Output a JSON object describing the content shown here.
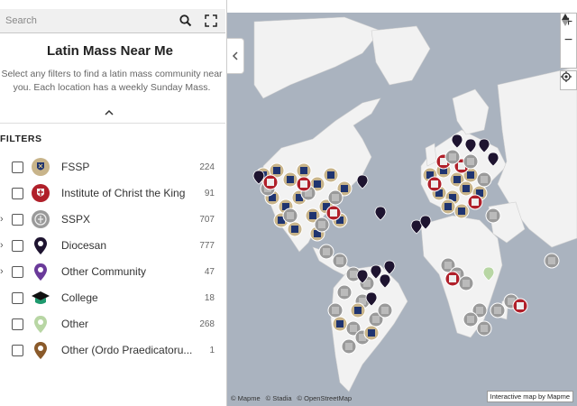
{
  "search": {
    "placeholder": "Search"
  },
  "icons": {
    "search": "search-icon",
    "fullscreen": "fullscreen-icon",
    "collapse": "chevron-up-icon",
    "panel": "chevron-left-icon"
  },
  "sidebar": {
    "title": "Latin Mass Near Me",
    "description": "Select any filters to find a latin mass community near you. Each location has a weekly Sunday Mass.",
    "filters_heading": "FILTERS",
    "filters": [
      {
        "label": "FSSP",
        "count": "224",
        "expandable": false,
        "icon": "fssp-crest-icon"
      },
      {
        "label": "Institute of Christ the King",
        "count": "91",
        "expandable": false,
        "icon": "icrss-crest-icon"
      },
      {
        "label": "SSPX",
        "count": "707",
        "expandable": true,
        "icon": "sspx-crest-icon"
      },
      {
        "label": "Diocesan",
        "count": "777",
        "expandable": true,
        "icon": "map-pin-dark-icon"
      },
      {
        "label": "Other Community",
        "count": "47",
        "expandable": true,
        "icon": "map-pin-purple-icon"
      },
      {
        "label": "College",
        "count": "18",
        "expandable": false,
        "icon": "graduation-cap-icon"
      },
      {
        "label": "Other",
        "count": "268",
        "expandable": false,
        "icon": "map-pin-green-icon"
      },
      {
        "label": "Other (Ordo Praedicatoru...",
        "count": "1",
        "expandable": false,
        "icon": "map-pin-brown-icon"
      }
    ]
  },
  "map": {
    "controls": {
      "zoom_in": "+",
      "zoom_out": "−",
      "compass": "compass-icon",
      "locate": "locate-icon"
    },
    "attribution": [
      "© Mapme",
      "© Stadia",
      "© OpenStreetMap"
    ],
    "credit": "Interactive map by Mapme"
  },
  "colors": {
    "water": "#aab3bf",
    "land": "#f2f2f2",
    "fssp": "#c8b48a",
    "icrss": "#b0202a",
    "sspx": "#9a9a9a",
    "diocesan": "#1e1430",
    "other_community": "#6a3a9a",
    "college": "#1e9a6e",
    "other": "#b8d6a4",
    "ordo": "#8a5a2a"
  }
}
